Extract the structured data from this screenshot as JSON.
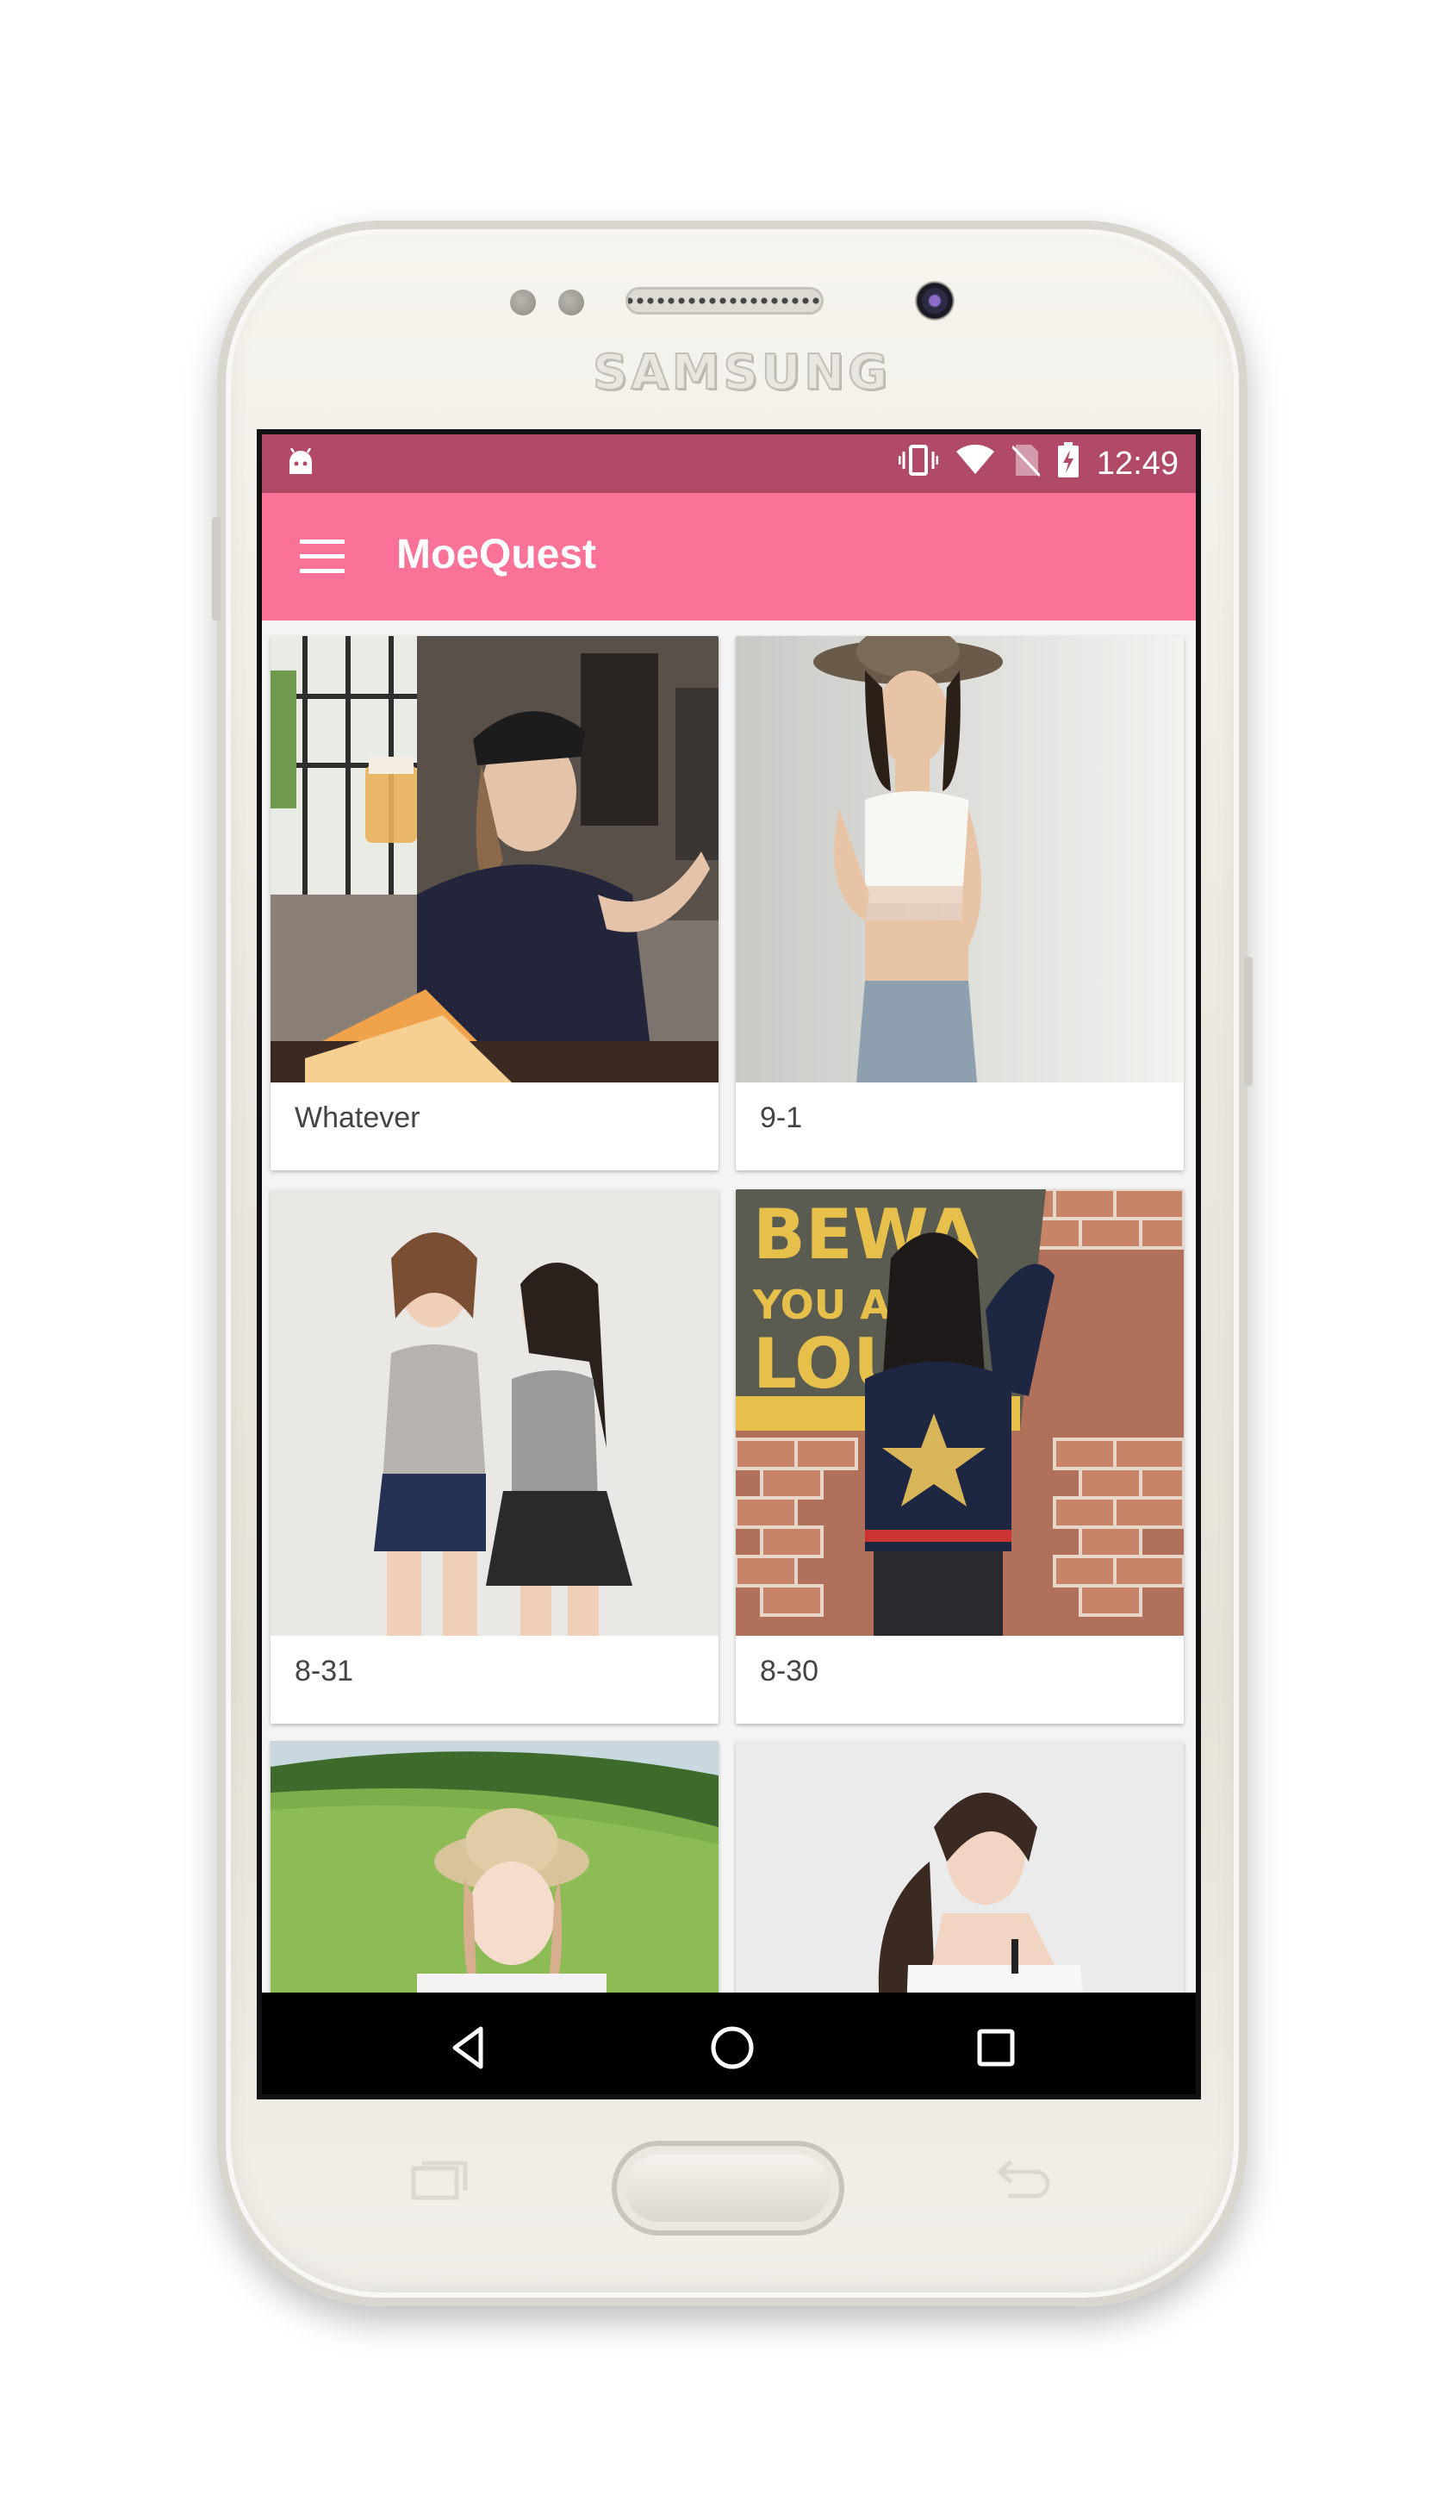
{
  "device": {
    "brand": "SAMSUNG"
  },
  "status_bar": {
    "time": "12:49",
    "icons": [
      "android-icon",
      "vibrate-icon",
      "wifi-icon",
      "no-sim-icon",
      "battery-charging-icon"
    ]
  },
  "app_bar": {
    "title": "MoeQuest",
    "menu_icon": "menu-icon"
  },
  "gallery": {
    "items": [
      {
        "caption": "Whatever"
      },
      {
        "caption": "9-1"
      },
      {
        "caption": "8-31"
      },
      {
        "caption": "8-30"
      },
      {
        "caption": ""
      },
      {
        "caption": ""
      }
    ]
  },
  "nav_bar": {
    "buttons": [
      "back-icon",
      "home-icon",
      "recents-icon"
    ]
  },
  "colors": {
    "accent": "#fb7299",
    "status_bar": "#b04a66",
    "nav_bar": "#000000"
  }
}
